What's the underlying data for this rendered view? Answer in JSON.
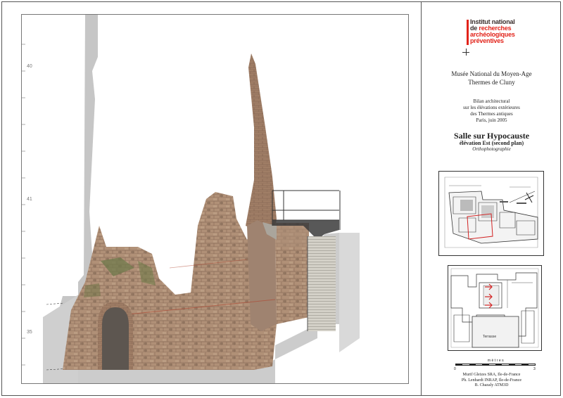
{
  "elevation_labels": [
    "40",
    "41",
    "35"
  ],
  "logo": {
    "line1": "Institut national",
    "line2a": "de ",
    "line2b": "recherches",
    "line3": "archéologiques",
    "line4": "préventives"
  },
  "museum": {
    "line1": "Musée National du Moyen-Age",
    "line2": "Thermes de Cluny"
  },
  "bilan": {
    "line1": "Bilan architectural",
    "line2": "sur les élévations extérieures",
    "line3": "des Thermes antiques",
    "line4": "Paris, juin 2005"
  },
  "title": {
    "main": "Salle sur Hypocauste",
    "sub": "élévation Est (second plan)",
    "type": "Orthophotographie"
  },
  "map2": {
    "label": "Terrasse"
  },
  "scale": {
    "unit": "mètres",
    "start": "0",
    "end": "3"
  },
  "credits": [
    "Murif Gleizes SRA, Ile-de-France",
    "Ph. Lenhardt INRAP, Ile-de-France",
    "B. Chazaly ATM3D"
  ],
  "colors": {
    "inrap_red": "#e2231a",
    "ground_grey": "#c6c6c6",
    "masonry": "#9a7a63",
    "plan_red": "#d22222"
  }
}
